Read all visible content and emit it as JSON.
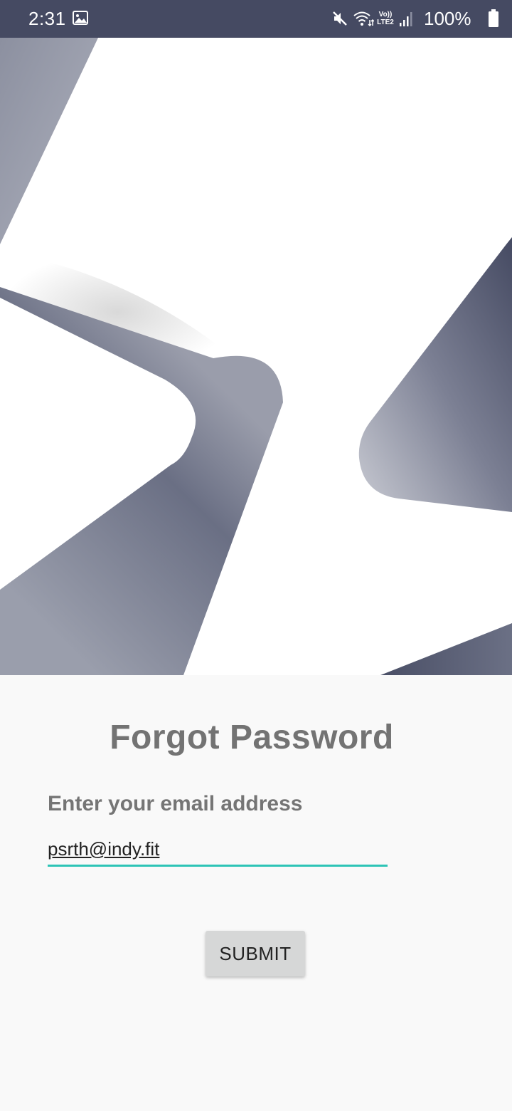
{
  "status_bar": {
    "time": "2:31",
    "volte_line1": "Vo))",
    "volte_line2": "LTE2",
    "battery_percent": "100%",
    "icons": [
      "image-icon",
      "mute-icon",
      "wifi-icon",
      "volte-icon",
      "signal-icon",
      "battery-icon"
    ]
  },
  "form": {
    "title": "Forgot Password",
    "email_label": "Enter your email address",
    "email_value": "psrth@indy.fit",
    "submit_label": "SUBMIT"
  },
  "colors": {
    "status_bar": "#454a62",
    "accent": "#2ec4b6",
    "title_text": "#737373",
    "button_bg": "#d6d7d7"
  }
}
